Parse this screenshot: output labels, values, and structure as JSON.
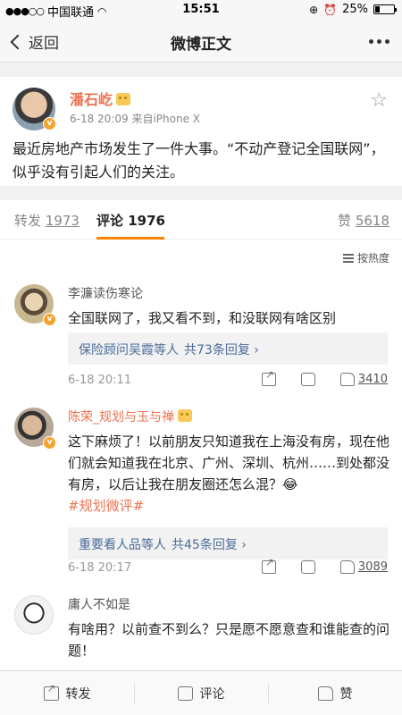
{
  "status_bar": {
    "signal": "●●●○○",
    "carrier": "中国联通",
    "wifi_icon": "wifi-icon",
    "time": "15:51",
    "battery": "25%",
    "battery_level": 0.25
  },
  "nav": {
    "back_label": "返回",
    "title": "微博正文"
  },
  "post": {
    "author": "潘石屹",
    "meta": "6-18 20:09  来自iPhone X",
    "text": "最近房地产市场发生了一件大事。“不动产登记全国联网”，似乎没有引起人们的关注。"
  },
  "tabs": {
    "repost_label": "转发",
    "repost_count": "1973",
    "comment_label": "评论",
    "comment_count": "1976",
    "like_label": "赞",
    "like_count": "5618"
  },
  "sort_label": "按热度",
  "comments": [
    {
      "name": "李濂读伤寒论",
      "text": "全国联网了，我又看不到，和没联网有啥区别",
      "reply_preview": "保险顾问吴霞等人",
      "reply_count": "共73条回复 ›",
      "date": "6-18 20:11",
      "likes": "3410"
    },
    {
      "name": "陈荣_规划与玉与禅",
      "text_main": "这下麻烦了！以前朋友只知道我在上海没有房，现在他们就会知道我在北京、广州、深圳、杭州……到处都没有房，以后让我在朋友圈还怎么混？😂",
      "tag": "#规划微评#",
      "reply_preview": "重要看人品等人",
      "reply_count": "共45条回复 ›",
      "date": "6-18 20:17",
      "likes": "3089"
    },
    {
      "name": "庸人不如是",
      "text": "有啥用？以前查不到么？只是愿不愿意查和谁能查的问题！"
    }
  ],
  "toolbar": {
    "repost": "转发",
    "comment": "评论",
    "like": "赞"
  },
  "colors": {
    "accent": "#ff8200",
    "name_vip": "#eb7350",
    "link": "#4a6d99"
  }
}
